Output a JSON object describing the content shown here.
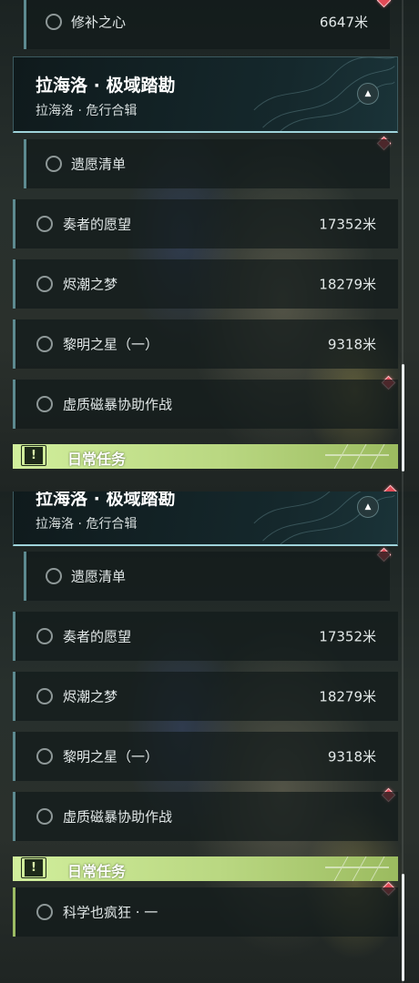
{
  "top_panel": {
    "prev_quest": {
      "name": "修补之心",
      "distance": "6647米"
    },
    "region": {
      "title": "拉海洛 · 极域踏勘",
      "subtitle": "拉海洛 · 危行合辑",
      "toggle_icon": "chevron-up-icon"
    },
    "quests": [
      {
        "name": "遗愿清单",
        "distance": ""
      },
      {
        "name": "奏者的愿望",
        "distance": "17352米"
      },
      {
        "name": "烬潮之梦",
        "distance": "18279米"
      },
      {
        "name": "黎明之星（一）",
        "distance": "9318米"
      },
      {
        "name": "虚质磁暴协助作战",
        "distance": ""
      }
    ],
    "daily": {
      "label": "日常任务",
      "icon": "exclamation-box-icon"
    }
  },
  "bottom_panel": {
    "region": {
      "title": "拉海洛 · 极域踏勘",
      "subtitle": "拉海洛 · 危行合辑",
      "toggle_icon": "chevron-up-icon"
    },
    "quests": [
      {
        "name": "遗愿清单",
        "distance": ""
      },
      {
        "name": "奏者的愿望",
        "distance": "17352米"
      },
      {
        "name": "烬潮之梦",
        "distance": "18279米"
      },
      {
        "name": "黎明之星（一）",
        "distance": "9318米"
      },
      {
        "name": "虚质磁暴协助作战",
        "distance": ""
      }
    ],
    "daily": {
      "label": "日常任务",
      "icon": "exclamation-box-icon",
      "quests": [
        {
          "name": "科学也疯狂 · 一",
          "distance": ""
        }
      ]
    }
  },
  "colors": {
    "accent_teal": "#5d8a90",
    "accent_green": "#9cbc63",
    "marker_red": "#e04a56",
    "daily_banner": "#c6e48f"
  }
}
